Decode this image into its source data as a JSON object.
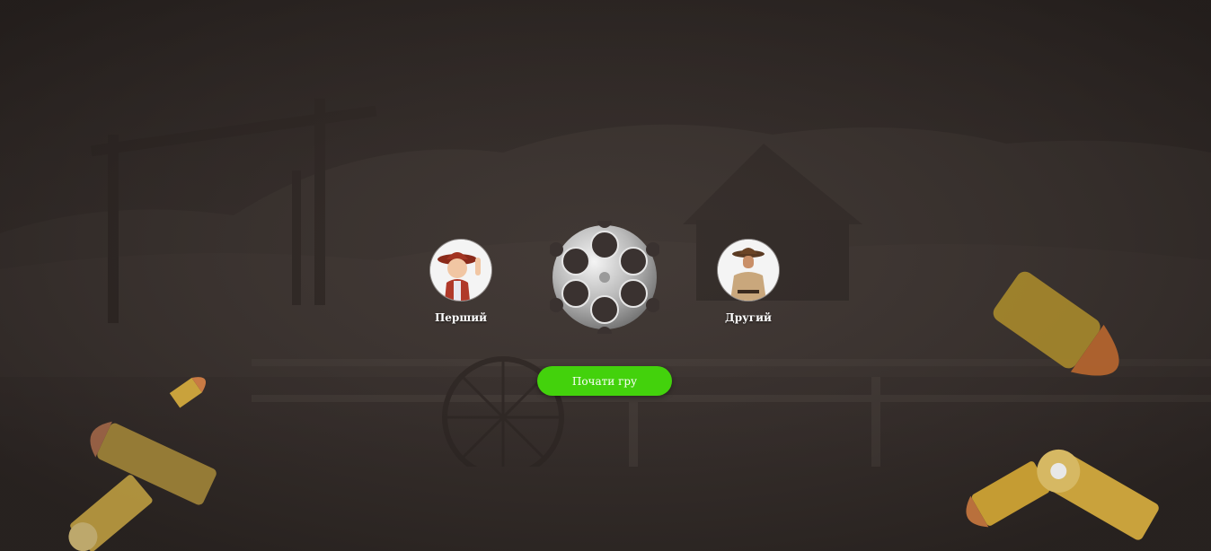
{
  "players": {
    "first": {
      "name": "Перший",
      "avatar_icon": "cowboy-kid-avatar-icon"
    },
    "second": {
      "name": "Другий",
      "avatar_icon": "cowboy-man-avatar-icon"
    }
  },
  "revolver": {
    "chambers": 6,
    "icon": "revolver-cylinder-icon"
  },
  "start_button": {
    "label": "Почати гру"
  },
  "colors": {
    "accent": "#43d20c",
    "background": "#2e2826",
    "text": "#ffffff"
  }
}
